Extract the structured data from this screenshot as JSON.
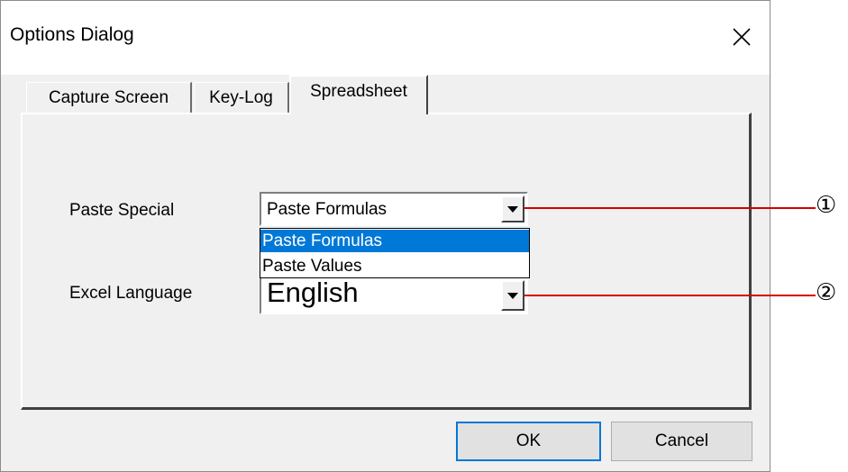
{
  "window": {
    "title": "Options Dialog"
  },
  "tabs": [
    {
      "label": "Capture Screen",
      "active": false
    },
    {
      "label": "Key-Log",
      "active": false
    },
    {
      "label": "Spreadsheet",
      "active": true
    }
  ],
  "paste_special": {
    "label": "Paste Special",
    "value": "Paste Formulas",
    "options": [
      "Paste Formulas",
      "Paste Values"
    ],
    "highlighted_option": "Paste Formulas"
  },
  "excel_language": {
    "label": "Excel Language",
    "value": "English"
  },
  "buttons": {
    "ok": "OK",
    "cancel": "Cancel"
  },
  "callouts": [
    "①",
    "②"
  ],
  "colors": {
    "callout_line": "#d40000",
    "selection": "#0078d7"
  },
  "icons": {
    "close": "close-icon",
    "dropdown": "chevron-down-icon"
  }
}
